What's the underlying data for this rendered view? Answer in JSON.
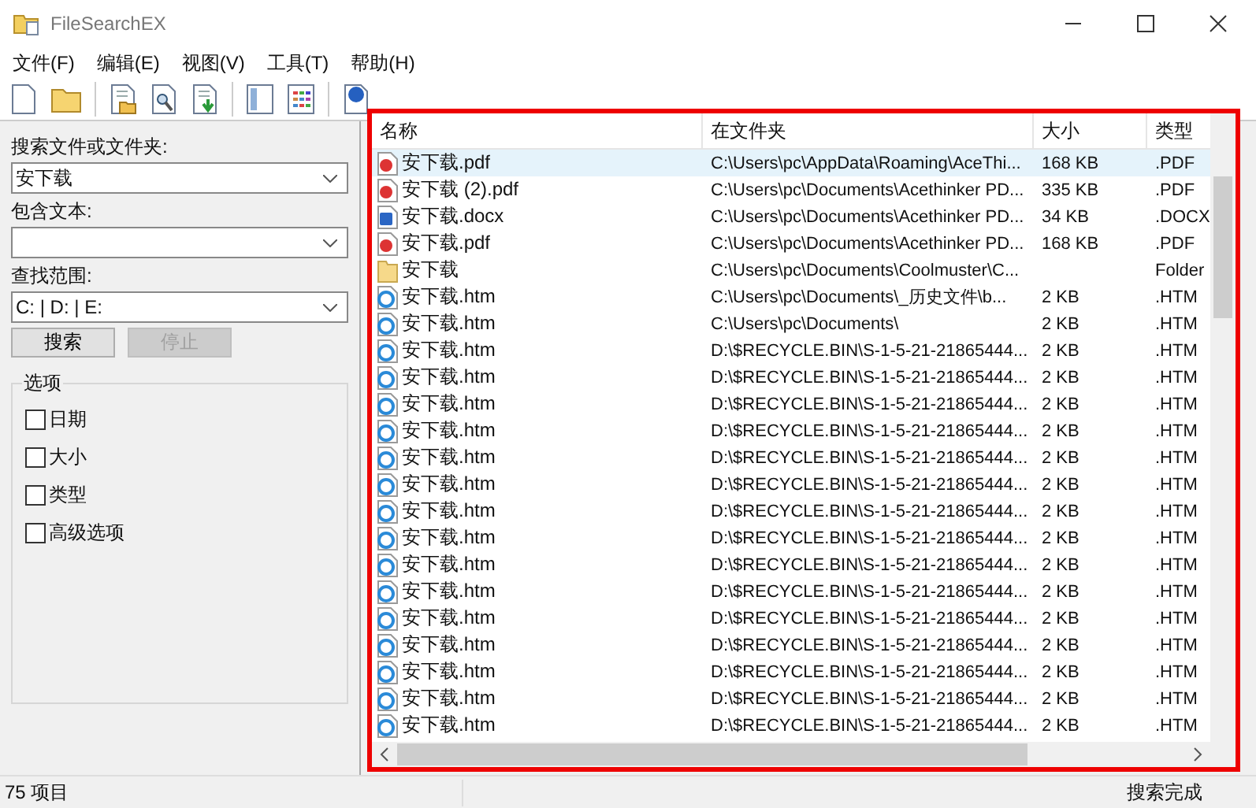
{
  "window": {
    "title": "FileSearchEX"
  },
  "menu": [
    "文件(F)",
    "编辑(E)",
    "视图(V)",
    "工具(T)",
    "帮助(H)"
  ],
  "search_panel": {
    "name_label": "搜索文件或文件夹:",
    "name_value": "安下载",
    "text_label": "包含文本:",
    "scope_label": "查找范围:",
    "scope_value": "C: | D: | E:",
    "buttons": [
      {
        "label": "搜索",
        "disabled": false
      },
      {
        "label": "停止",
        "disabled": true
      }
    ],
    "options_title": "选项",
    "options": [
      {
        "label": "日期",
        "checked": false
      },
      {
        "label": "大小",
        "checked": false
      },
      {
        "label": "类型",
        "checked": false
      },
      {
        "label": "高级选项",
        "checked": false
      }
    ]
  },
  "table": {
    "columns": [
      "名称",
      "在文件夹",
      "大小",
      "类型"
    ],
    "rows": [
      {
        "kind": "pdf",
        "name": "安下载.pdf",
        "folder": "C:\\Users\\pc\\AppData\\Roaming\\AceThi...",
        "size": "168 KB",
        "type": ".PDF",
        "selected": true
      },
      {
        "kind": "pdf",
        "name": "安下载 (2).pdf",
        "folder": "C:\\Users\\pc\\Documents\\Acethinker PD...",
        "size": "335 KB",
        "type": ".PDF",
        "selected": false
      },
      {
        "kind": "docx",
        "name": "安下载.docx",
        "folder": "C:\\Users\\pc\\Documents\\Acethinker PD...",
        "size": "34 KB",
        "type": ".DOCX",
        "selected": false
      },
      {
        "kind": "pdf",
        "name": "安下载.pdf",
        "folder": "C:\\Users\\pc\\Documents\\Acethinker PD...",
        "size": "168 KB",
        "type": ".PDF",
        "selected": false
      },
      {
        "kind": "folder",
        "name": "安下载",
        "folder": "C:\\Users\\pc\\Documents\\Coolmuster\\C...",
        "type": "Folder",
        "selected": false
      },
      {
        "kind": "htm",
        "name": "安下载.htm",
        "folder": "C:\\Users\\pc\\Documents\\_历史文件\\b...",
        "size": "2 KB",
        "type": ".HTM",
        "selected": false
      },
      {
        "kind": "htm",
        "name": "安下载.htm",
        "folder": "C:\\Users\\pc\\Documents\\",
        "size": "2 KB",
        "type": ".HTM",
        "selected": false
      },
      {
        "kind": "htm",
        "name": "安下载.htm",
        "folder": "D:\\$RECYCLE.BIN\\S-1-5-21-21865444...",
        "size": "2 KB",
        "type": ".HTM",
        "selected": false
      },
      {
        "kind": "htm",
        "name": "安下载.htm",
        "folder": "D:\\$RECYCLE.BIN\\S-1-5-21-21865444...",
        "size": "2 KB",
        "type": ".HTM",
        "selected": false
      },
      {
        "kind": "htm",
        "name": "安下载.htm",
        "folder": "D:\\$RECYCLE.BIN\\S-1-5-21-21865444...",
        "size": "2 KB",
        "type": ".HTM",
        "selected": false
      },
      {
        "kind": "htm",
        "name": "安下载.htm",
        "folder": "D:\\$RECYCLE.BIN\\S-1-5-21-21865444...",
        "size": "2 KB",
        "type": ".HTM",
        "selected": false
      },
      {
        "kind": "htm",
        "name": "安下载.htm",
        "folder": "D:\\$RECYCLE.BIN\\S-1-5-21-21865444...",
        "size": "2 KB",
        "type": ".HTM",
        "selected": false
      },
      {
        "kind": "htm",
        "name": "安下载.htm",
        "folder": "D:\\$RECYCLE.BIN\\S-1-5-21-21865444...",
        "size": "2 KB",
        "type": ".HTM",
        "selected": false
      },
      {
        "kind": "htm",
        "name": "安下载.htm",
        "folder": "D:\\$RECYCLE.BIN\\S-1-5-21-21865444...",
        "size": "2 KB",
        "type": ".HTM",
        "selected": false
      },
      {
        "kind": "htm",
        "name": "安下载.htm",
        "folder": "D:\\$RECYCLE.BIN\\S-1-5-21-21865444...",
        "size": "2 KB",
        "type": ".HTM",
        "selected": false
      },
      {
        "kind": "htm",
        "name": "安下载.htm",
        "folder": "D:\\$RECYCLE.BIN\\S-1-5-21-21865444...",
        "size": "2 KB",
        "type": ".HTM",
        "selected": false
      },
      {
        "kind": "htm",
        "name": "安下载.htm",
        "folder": "D:\\$RECYCLE.BIN\\S-1-5-21-21865444...",
        "size": "2 KB",
        "type": ".HTM",
        "selected": false
      },
      {
        "kind": "htm",
        "name": "安下载.htm",
        "folder": "D:\\$RECYCLE.BIN\\S-1-5-21-21865444...",
        "size": "2 KB",
        "type": ".HTM",
        "selected": false
      },
      {
        "kind": "htm",
        "name": "安下载.htm",
        "folder": "D:\\$RECYCLE.BIN\\S-1-5-21-21865444...",
        "size": "2 KB",
        "type": ".HTM",
        "selected": false
      },
      {
        "kind": "htm",
        "name": "安下载.htm",
        "folder": "D:\\$RECYCLE.BIN\\S-1-5-21-21865444...",
        "size": "2 KB",
        "type": ".HTM",
        "selected": false
      },
      {
        "kind": "htm",
        "name": "安下载.htm",
        "folder": "D:\\$RECYCLE.BIN\\S-1-5-21-21865444...",
        "size": "2 KB",
        "type": ".HTM",
        "selected": false
      },
      {
        "kind": "htm",
        "name": "安下载.htm",
        "folder": "D:\\$RECYCLE.BIN\\S-1-5-21-21865444...",
        "size": "2 KB",
        "type": ".HTM",
        "selected": false
      }
    ]
  },
  "status_bar": {
    "count": "75 项目",
    "message": "搜索完成"
  }
}
